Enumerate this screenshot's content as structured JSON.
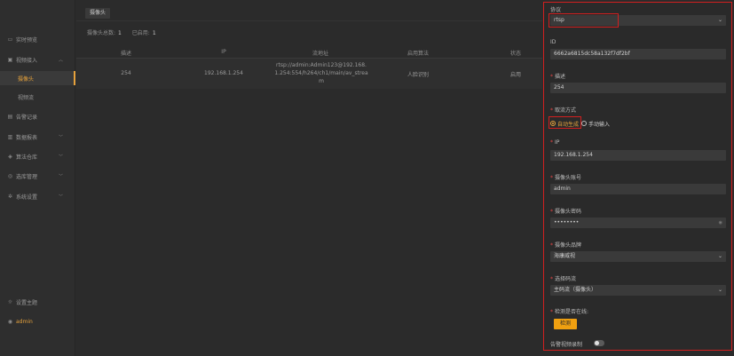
{
  "sidebar": {
    "items": [
      {
        "label": "实时预览",
        "icon": "monitor-icon"
      },
      {
        "label": "视频接入",
        "icon": "video-icon"
      },
      {
        "label": "摄像头",
        "icon": ""
      },
      {
        "label": "视频流",
        "icon": ""
      },
      {
        "label": "告警记录",
        "icon": "alarm-icon"
      },
      {
        "label": "数据报表",
        "icon": "chart-icon"
      },
      {
        "label": "算法仓库",
        "icon": "cube-icon"
      },
      {
        "label": "选库管理",
        "icon": "database-icon"
      },
      {
        "label": "系统设置",
        "icon": "gear-icon"
      }
    ],
    "theme_label": "设置主题",
    "user_label": "admin"
  },
  "main": {
    "tab_label": "摄像头",
    "stats": {
      "total_label": "摄像头总数:",
      "total_value": "1",
      "enabled_label": "已启用:",
      "enabled_value": "1"
    },
    "table": {
      "headers": [
        "描述",
        "IP",
        "流地址",
        "启用算法",
        "状态"
      ],
      "rows": [
        {
          "desc": "254",
          "ip": "192.168.1.254",
          "stream_line1": "rtsp://admin:Admin123@192.168.",
          "stream_line2": "1.254:554/h264/ch1/main/av_strea",
          "stream_line3": "m",
          "algo": "人脸识别",
          "status": "启用"
        }
      ]
    }
  },
  "form": {
    "protocol_label": "协议",
    "protocol_value": "rtsp",
    "id_label": "ID",
    "id_value": "6662a6815dc58a132f7df2bf",
    "desc_label": "描述",
    "desc_value": "254",
    "stream_mode_label": "取流方式",
    "stream_mode_auto": "自动生成",
    "stream_mode_manual": "手动输入",
    "ip_label": "IP",
    "ip_value": "192.168.1.254",
    "account_label": "摄像头账号",
    "account_value": "admin",
    "password_label": "摄像头密码",
    "password_value": "••••••••",
    "brand_label": "摄像头品牌",
    "brand_value": "海康威视",
    "stream_select_label": "选择码流",
    "stream_select_value": "主码流（摄像头）",
    "online_label": "检测是否在线:",
    "detect_button": "检测",
    "record_label": "告警视频录制"
  },
  "colors": {
    "accent": "#f0a010",
    "highlight_border": "#d11f1f",
    "required": "#e64545"
  }
}
